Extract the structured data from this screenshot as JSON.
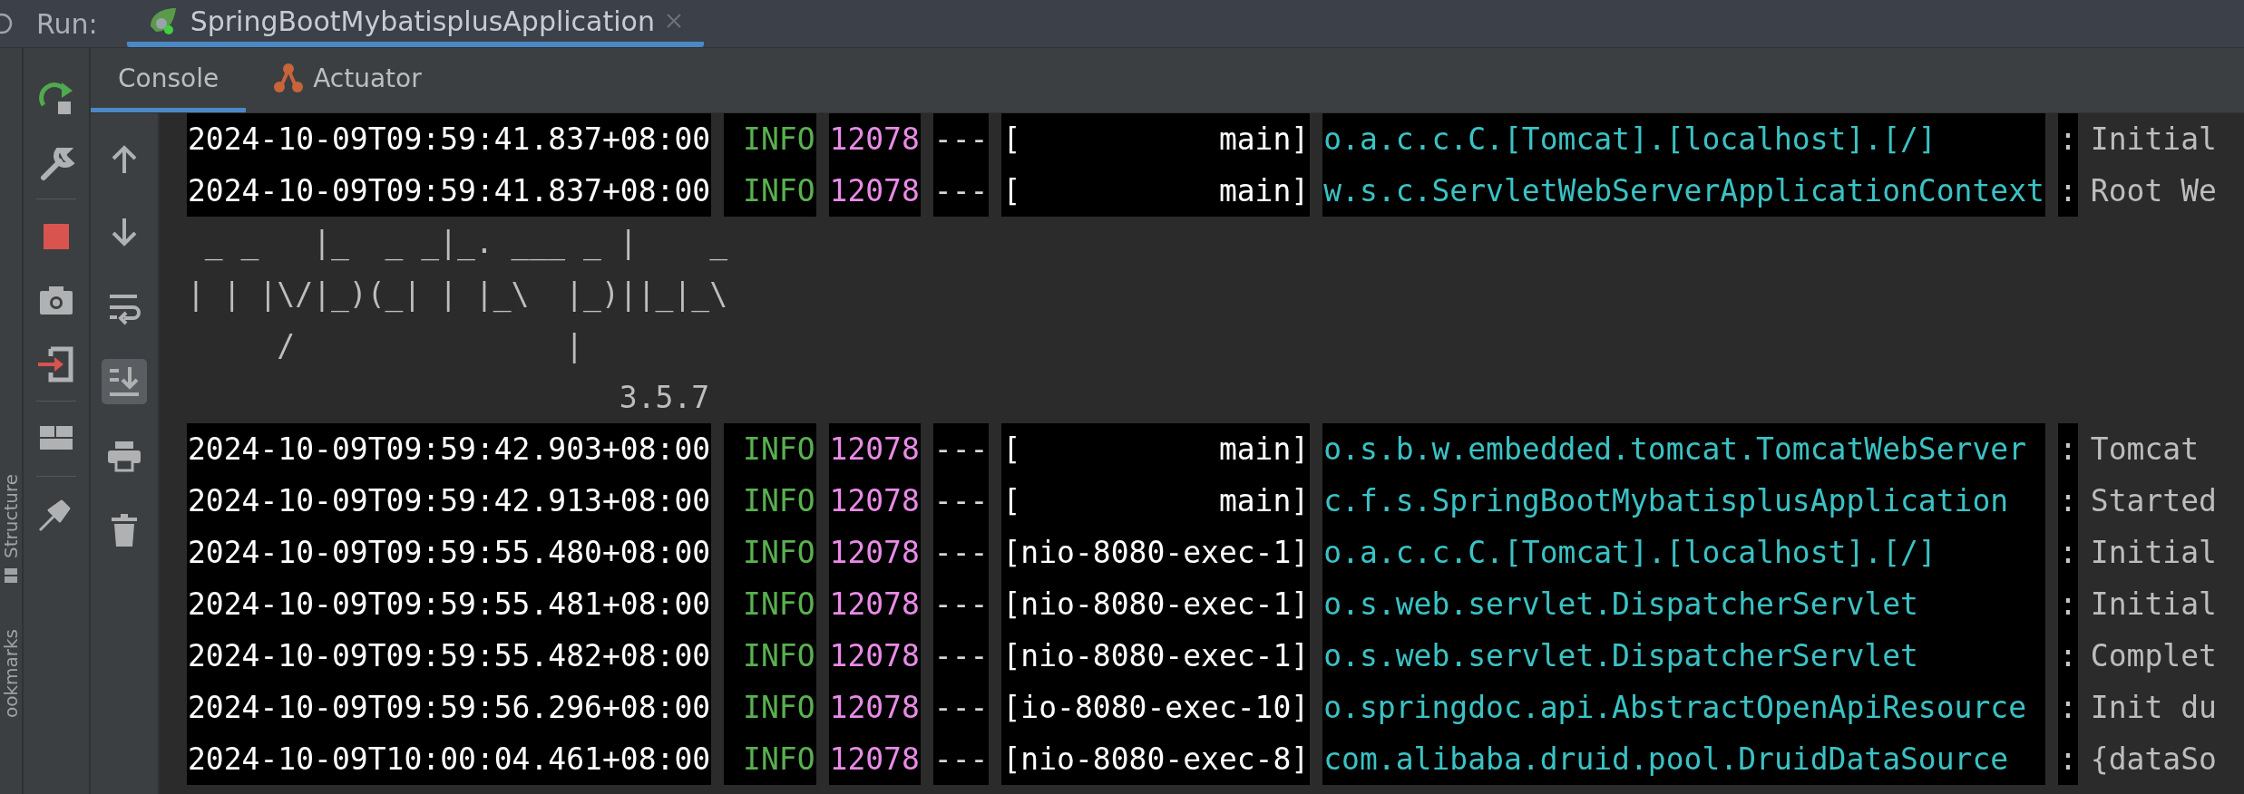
{
  "run_bar": {
    "label": "Run:",
    "tab": {
      "title": "SpringBootMybatisplusApplication",
      "selected": true
    }
  },
  "side_panels": [
    {
      "label": "Structure",
      "kind": "structure"
    },
    {
      "label": "ookmarks",
      "kind": "bookmarks"
    }
  ],
  "console_tabs": [
    {
      "label": "Console",
      "selected": true,
      "kind": "console"
    },
    {
      "label": "Actuator",
      "selected": false,
      "kind": "actuator"
    }
  ],
  "console_toolbar": [
    {
      "kind": "up",
      "on": false
    },
    {
      "kind": "down",
      "on": false
    },
    {
      "kind": "wrap",
      "on": false
    },
    {
      "kind": "scroll-end",
      "on": true
    },
    {
      "kind": "print",
      "on": false
    },
    {
      "kind": "clear",
      "on": false
    }
  ],
  "console": {
    "lines": [
      {
        "kind": "log",
        "timestamp": "2024-10-09T09:59:41.837+08:00",
        "level": " INFO",
        "pid": "12078",
        "separator": "---",
        "thread": "[           main]",
        "logger": "o.a.c.c.C.[Tomcat].[localhost].[/]",
        "colon": ":",
        "message": "Initial"
      },
      {
        "kind": "log",
        "timestamp": "2024-10-09T09:59:41.837+08:00",
        "level": " INFO",
        "pid": "12078",
        "separator": "---",
        "thread": "[           main]",
        "logger": "w.s.c.ServletWebServerApplicationContext",
        "colon": ":",
        "message": "Root We"
      },
      {
        "kind": "banner",
        "text": " _ _   |_  _ _|_. ___ _ |    _"
      },
      {
        "kind": "banner",
        "text": "| | |\\/|_)(_| | |_\\  |_)||_|_\\"
      },
      {
        "kind": "banner",
        "text": "     /               |"
      },
      {
        "kind": "banner",
        "text": "                        3.5.7"
      },
      {
        "kind": "log",
        "timestamp": "2024-10-09T09:59:42.903+08:00",
        "level": " INFO",
        "pid": "12078",
        "separator": "---",
        "thread": "[           main]",
        "logger": "o.s.b.w.embedded.tomcat.TomcatWebServer",
        "colon": ":",
        "message": "Tomcat"
      },
      {
        "kind": "log",
        "timestamp": "2024-10-09T09:59:42.913+08:00",
        "level": " INFO",
        "pid": "12078",
        "separator": "---",
        "thread": "[           main]",
        "logger": "c.f.s.SpringBootMybatisplusApplication",
        "colon": ":",
        "message": "Started"
      },
      {
        "kind": "log",
        "timestamp": "2024-10-09T09:59:55.480+08:00",
        "level": " INFO",
        "pid": "12078",
        "separator": "---",
        "thread": "[nio-8080-exec-1]",
        "logger": "o.a.c.c.C.[Tomcat].[localhost].[/]",
        "colon": ":",
        "message": "Initial"
      },
      {
        "kind": "log",
        "timestamp": "2024-10-09T09:59:55.481+08:00",
        "level": " INFO",
        "pid": "12078",
        "separator": "---",
        "thread": "[nio-8080-exec-1]",
        "logger": "o.s.web.servlet.DispatcherServlet",
        "colon": ":",
        "message": "Initial"
      },
      {
        "kind": "log",
        "timestamp": "2024-10-09T09:59:55.482+08:00",
        "level": " INFO",
        "pid": "12078",
        "separator": "---",
        "thread": "[nio-8080-exec-1]",
        "logger": "o.s.web.servlet.DispatcherServlet",
        "colon": ":",
        "message": "Complet"
      },
      {
        "kind": "log",
        "timestamp": "2024-10-09T09:59:56.296+08:00",
        "level": " INFO",
        "pid": "12078",
        "separator": "---",
        "thread": "[io-8080-exec-10]",
        "logger": "o.springdoc.api.AbstractOpenApiResource",
        "colon": ":",
        "message": "Init du"
      },
      {
        "kind": "log",
        "timestamp": "2024-10-09T10:00:04.461+08:00",
        "level": " INFO",
        "pid": "12078",
        "separator": "---",
        "thread": "[nio-8080-exec-8]",
        "logger": "com.alibaba.druid.pool.DruidDataSource",
        "colon": ":",
        "message": "{dataSo"
      }
    ]
  }
}
